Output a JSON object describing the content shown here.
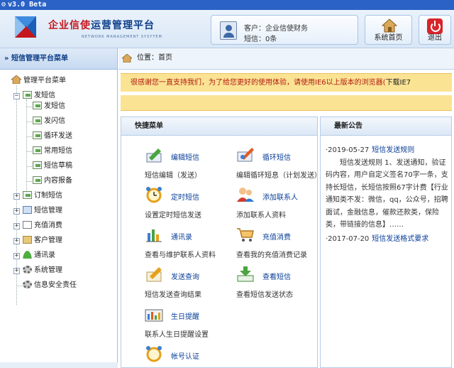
{
  "window": {
    "title": "v3.0 Beta"
  },
  "header": {
    "brand_red": "企业信使",
    "brand_rest": "运营管理平台",
    "brand_sub": "NETWORK MANAGEMENT SYSYTEM",
    "customer": "客户：企业信使财务",
    "sms_balance": "短信：0条",
    "home_label": "系统首页",
    "exit_label": "退出"
  },
  "sidebar": {
    "title": "» 短信管理平台菜单",
    "root": "管理平台菜单",
    "items": [
      {
        "label": "发短信",
        "expanded": true,
        "children": [
          "发短信",
          "发闪信",
          "循环发送",
          "常用短信",
          "短信草稿",
          "内容报备"
        ]
      },
      {
        "label": "订制短信"
      },
      {
        "label": "短信管理"
      },
      {
        "label": "充值消费"
      },
      {
        "label": "客户管理"
      },
      {
        "label": "通讯录"
      },
      {
        "label": "系统管理"
      },
      {
        "label": "信息安全责任"
      }
    ]
  },
  "main": {
    "breadcrumb": "位置：首页",
    "notice": "很感谢您一直支持我们，为了给您更好的使用体验，请使用IE6以上版本的浏览器(",
    "notice_link": "下载IE7",
    "quick": {
      "title": "快捷菜单",
      "items": [
        {
          "title": "编辑短信",
          "desc": "短信编辑（发送）",
          "icon": "edit-sms-icon"
        },
        {
          "title": "循环短信",
          "desc": "编辑循环短息（计划发送）",
          "icon": "loop-sms-icon"
        },
        {
          "title": "定时短信",
          "desc": "设置定时短信发送",
          "icon": "alarm-clock-icon"
        },
        {
          "title": "添加联系人",
          "desc": "添加联系人资料",
          "icon": "add-contact-icon"
        },
        {
          "title": "通讯录",
          "desc": "查看与维护联系人资料",
          "icon": "address-book-icon"
        },
        {
          "title": "充值消费",
          "desc": "查看我的充值消费记录",
          "icon": "shopping-cart-icon"
        },
        {
          "title": "发送查询",
          "desc": "短信发送查询结果",
          "icon": "send-query-icon"
        },
        {
          "title": "查看短信",
          "desc": "查看短信发送状态",
          "icon": "download-icon"
        },
        {
          "title": "生日提醒",
          "desc": "联系人生日提醒设置",
          "icon": "bar-chart-icon"
        },
        {
          "title": "帐号认证",
          "desc": "",
          "icon": "alarm-clock-icon"
        }
      ]
    },
    "news": {
      "title": "最新公告",
      "items": [
        {
          "date": "·2019-05-27",
          "title": "短信发送规则",
          "body": "短信发送规则 1、发送通知，验证码内容，用户自定义签名70字一条，支持长短信，长短信按照67字计费【行业通知类不发：微信，qq，公众号，招聘面试，金融信息，催款还款类，保险类，带链接的信息】……"
        },
        {
          "date": "·2017-07-20",
          "title": "短信发送格式要求",
          "body": ""
        }
      ]
    }
  },
  "colors": {
    "titlebar": "#2b62c6",
    "brand_blue": "#0c3f8a",
    "brand_red": "#c5161d",
    "notice_bg": "#fbe394",
    "link": "#0a3f99"
  }
}
